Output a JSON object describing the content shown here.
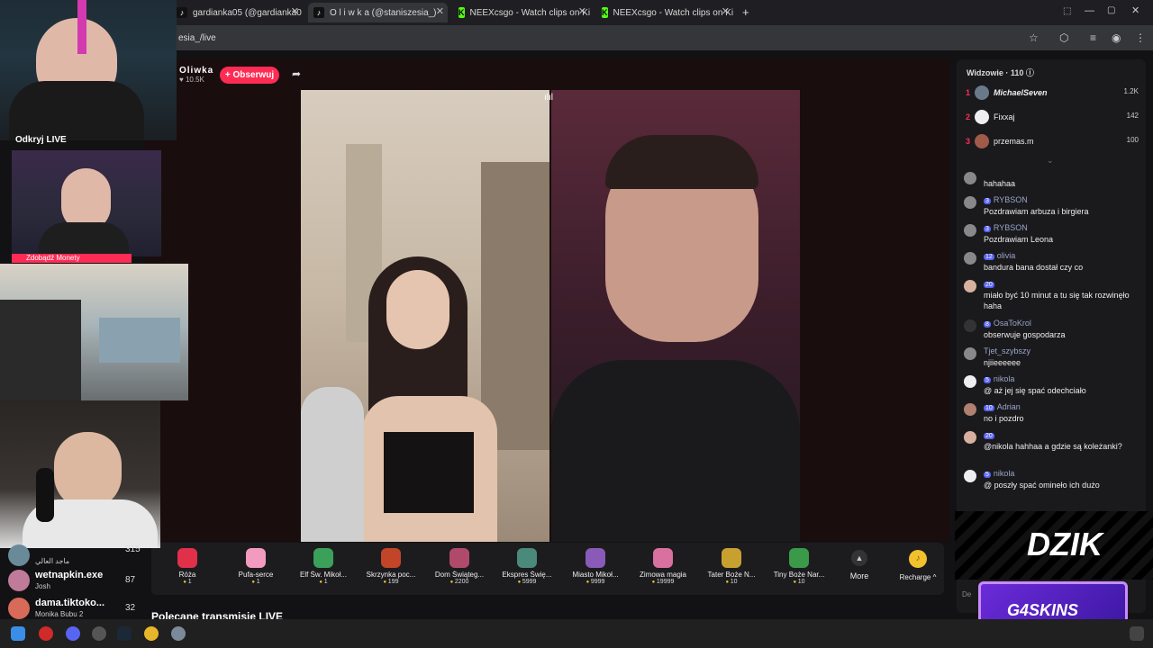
{
  "browser": {
    "tabs": [
      {
        "label": "gardianka05 (@gardianka0",
        "icon": "tiktok-icon"
      },
      {
        "label": "O l i w k a (@staniszesia_)",
        "icon": "tiktok-icon"
      },
      {
        "label": "NEEXcsgo - Watch clips on Kick",
        "icon": "kick-icon"
      },
      {
        "label": "NEEXcsgo - Watch clips on Kick",
        "icon": "kick-icon"
      }
    ],
    "new_tab": "+",
    "url": "esia_/live"
  },
  "stream": {
    "host_name": "Oliwka",
    "host_likes": "♥ 10.5K",
    "follow_label": "+ Obserwuj"
  },
  "gifts": [
    {
      "name": "Róża",
      "price": "1",
      "color": "#e0304a"
    },
    {
      "name": "Pufa-serce",
      "price": "1",
      "color": "#f29ac0"
    },
    {
      "name": "Elf Św. Mikoł...",
      "price": "1",
      "color": "#3aa05a"
    },
    {
      "name": "Skrzynka poc...",
      "price": "199",
      "color": "#c2452a"
    },
    {
      "name": "Dom Świąteg...",
      "price": "2200",
      "color": "#b04a6a"
    },
    {
      "name": "Ekspres Świę...",
      "price": "5999",
      "color": "#4a8a7a"
    },
    {
      "name": "Miasto Mikoł...",
      "price": "9999",
      "color": "#8a5ab8"
    },
    {
      "name": "Zimowa magia",
      "price": "19999",
      "color": "#d870a0"
    },
    {
      "name": "Tater Boże N...",
      "price": "10",
      "color": "#c8a030"
    },
    {
      "name": "Tiny Boże Nar...",
      "price": "10",
      "color": "#3a9a4a"
    }
  ],
  "more_label": "More",
  "recharge_label": "Recharge ^",
  "recommended_label": "Polecane transmisje LIVE",
  "viewers": {
    "title": "Widzowie · 110 ⓘ",
    "top": [
      {
        "rank": "1",
        "name": "MichaelSeven",
        "score": "1.2K"
      },
      {
        "rank": "2",
        "name": "Fixxaj",
        "score": "142"
      },
      {
        "rank": "3",
        "name": "przemas.m",
        "score": "100"
      }
    ]
  },
  "chat": [
    {
      "badge": "",
      "user": "",
      "text": "hahahaa"
    },
    {
      "badge": "3",
      "user": "RYBSON",
      "text": "Pozdrawiam arbuza i birgiera"
    },
    {
      "badge": "3",
      "user": "RYBSON",
      "text": "Pozdrawiam Leona"
    },
    {
      "badge": "12",
      "user": "olivia",
      "text": "bandura bana dostał czy co"
    },
    {
      "badge": "20",
      "user": "",
      "text": "miało być 10 minut a tu się tak rozwinęło haha"
    },
    {
      "badge": "8",
      "user": "OsaToKrol",
      "text": " obserwuje gospodarza"
    },
    {
      "badge": "",
      "user": "Tjet_szybszy",
      "text": "njiieeeeee"
    },
    {
      "badge": "5",
      "user": "nikola",
      "text": "@ aż jej się spać odechciało"
    },
    {
      "badge": "10",
      "user": "Adrian",
      "text": "no i pozdro"
    },
    {
      "badge": "20",
      "user": "",
      "text": "@nikola hahhaa a gdzie są koleżanki?"
    },
    {
      "badge": "5",
      "user": "nikola",
      "text": "@ poszły spać omineło ich dużo"
    }
  ],
  "chat_input_placeholder": "De",
  "sidebar_live": [
    {
      "name": "wetnapkin.exe",
      "sub": "Josh",
      "count": "87"
    },
    {
      "name": "dama.tiktoko...",
      "sub": "Monika Bubu 2",
      "count": "32"
    }
  ],
  "sidebar_live_partial": {
    "sub": "ماجد العالي",
    "count": "315"
  },
  "overlay": {
    "discover_label": "Odkryj LIVE",
    "coins_label": "Zdobądź Monety",
    "dzik_text": "DZIK",
    "g4_text": "G4SKINS"
  },
  "colors": {
    "accent": "#fe2c55",
    "badge": "#5865f2"
  }
}
